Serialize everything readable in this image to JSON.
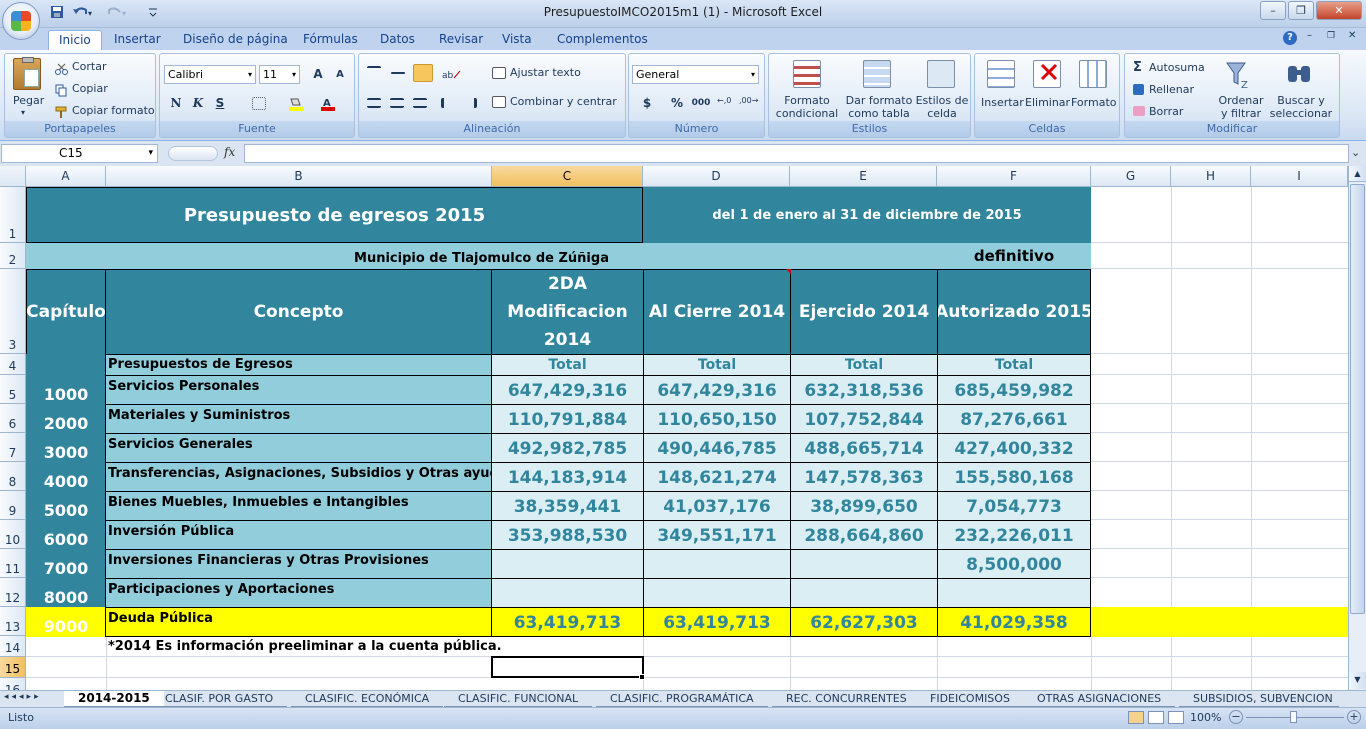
{
  "window": {
    "title": "PresupuestoIMCO2015m1 (1) - Microsoft Excel",
    "min_btn": "–",
    "max_btn": "❐",
    "close_btn": "✕",
    "help_btn": "?"
  },
  "tabs": [
    "Inicio",
    "Insertar",
    "Diseño de página",
    "Fórmulas",
    "Datos",
    "Revisar",
    "Vista",
    "Complementos"
  ],
  "ribbon": {
    "portapapeles": {
      "label": "Portapapeles",
      "paste": "Pegar",
      "cut": "Cortar",
      "copy": "Copiar",
      "format_painter": "Copiar formato"
    },
    "fuente": {
      "label": "Fuente",
      "font": "Calibri",
      "size": "11",
      "grow": "A",
      "shrink": "A",
      "bold": "N",
      "italic": "K",
      "underline": "S"
    },
    "alineacion": {
      "label": "Alineación",
      "wrap": "Ajustar texto",
      "merge": "Combinar y centrar"
    },
    "numero": {
      "label": "Número",
      "format": "General",
      "currency": "$",
      "percent": "%",
      "thousands": "000"
    },
    "estilos": {
      "label": "Estilos",
      "conditional": "Formato condicional",
      "as_table": "Dar formato como tabla",
      "cell_styles": "Estilos de celda"
    },
    "celdas": {
      "label": "Celdas",
      "insert": "Insertar",
      "delete": "Eliminar",
      "format": "Formato"
    },
    "modificar": {
      "label": "Modificar",
      "autosum": "Autosuma",
      "fill": "Rellenar",
      "clear": "Borrar",
      "sort": "Ordenar y filtrar",
      "find": "Buscar y seleccionar"
    }
  },
  "formula_bar": {
    "name_box": "C15",
    "fx": "fx",
    "formula": ""
  },
  "columns": [
    "A",
    "B",
    "C",
    "D",
    "E",
    "F",
    "G",
    "H",
    "I"
  ],
  "rows": [
    "1",
    "2",
    "3",
    "4",
    "5",
    "6",
    "7",
    "8",
    "9",
    "10",
    "11",
    "12",
    "13",
    "14",
    "15",
    "16"
  ],
  "sheet": {
    "title": "Presupuesto de egresos 2015",
    "period": "del 1 de enero al 31 de diciembre de 2015",
    "municipality": "Municipio de Tlajomulco de Zúñiga",
    "status": "definitivo",
    "header_capitulo": "Capítulo",
    "header_concepto": "Concepto",
    "header_c": "2DA Modificacion 2014",
    "header_d": "Al Cierre 2014",
    "header_e": "Ejercido 2014",
    "header_f": "Autorizado 2015",
    "subheader_concept": "Presupuestos de Egresos",
    "total": "Total",
    "data": [
      {
        "cap": "1000",
        "concept": "Servicios Personales",
        "c": "647,429,316",
        "d": "647,429,316",
        "e": "632,318,536",
        "f": "685,459,982"
      },
      {
        "cap": "2000",
        "concept": "Materiales y Suministros",
        "c": "110,791,884",
        "d": "110,650,150",
        "e": "107,752,844",
        "f": "87,276,661"
      },
      {
        "cap": "3000",
        "concept": "Servicios Generales",
        "c": "492,982,785",
        "d": "490,446,785",
        "e": "488,665,714",
        "f": "427,400,332"
      },
      {
        "cap": "4000",
        "concept": "Transferencias, Asignaciones, Subsidios y Otras ayudas",
        "c": "144,183,914",
        "d": "148,621,274",
        "e": "147,578,363",
        "f": "155,580,168"
      },
      {
        "cap": "5000",
        "concept": "Bienes Muebles, Inmuebles e Intangibles",
        "c": "38,359,441",
        "d": "41,037,176",
        "e": "38,899,650",
        "f": "7,054,773"
      },
      {
        "cap": "6000",
        "concept": "Inversión Pública",
        "c": "353,988,530",
        "d": "349,551,171",
        "e": "288,664,860",
        "f": "232,226,011"
      },
      {
        "cap": "7000",
        "concept": "Inversiones Financieras y Otras Provisiones",
        "c": "",
        "d": "",
        "e": "",
        "f": "8,500,000"
      },
      {
        "cap": "8000",
        "concept": "Participaciones y Aportaciones",
        "c": "",
        "d": "",
        "e": "",
        "f": ""
      },
      {
        "cap": "9000",
        "concept": "Deuda Pública",
        "c": "63,419,713",
        "d": "63,419,713",
        "e": "62,627,303",
        "f": "41,029,358"
      }
    ],
    "note": "*2014 Es información preeliminar a la cuenta pública."
  },
  "sheet_tabs": [
    "2014-2015",
    "CLASIF. POR GASTO",
    "CLASIFIC. ECONÓMICA",
    "CLASIFIC. FUNCIONAL",
    "CLASIFIC. PROGRAMÁTICA",
    "REC. CONCURRENTES",
    "FIDEICOMISOS",
    "OTRAS ASIGNACIONES",
    "SUBSIDIOS, SUBVENCION"
  ],
  "status_bar": {
    "ready": "Listo",
    "zoom": "100%",
    "zoom_out": "−",
    "zoom_in": "+"
  }
}
